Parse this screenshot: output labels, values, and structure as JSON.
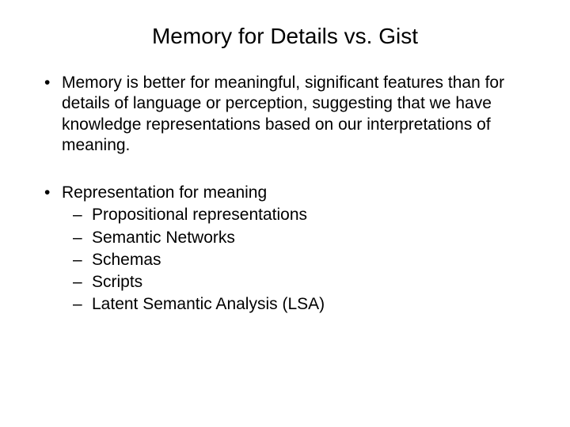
{
  "title": "Memory for Details vs. Gist",
  "bullets": [
    {
      "text": "Memory is better for meaningful, significant features than for details of language or perception, suggesting that we have knowledge representations based on our interpretations of meaning."
    },
    {
      "text": "Representation for meaning",
      "sub": [
        "Propositional representations",
        "Semantic Networks",
        "Schemas",
        "Scripts",
        "Latent Semantic Analysis (LSA)"
      ]
    }
  ]
}
